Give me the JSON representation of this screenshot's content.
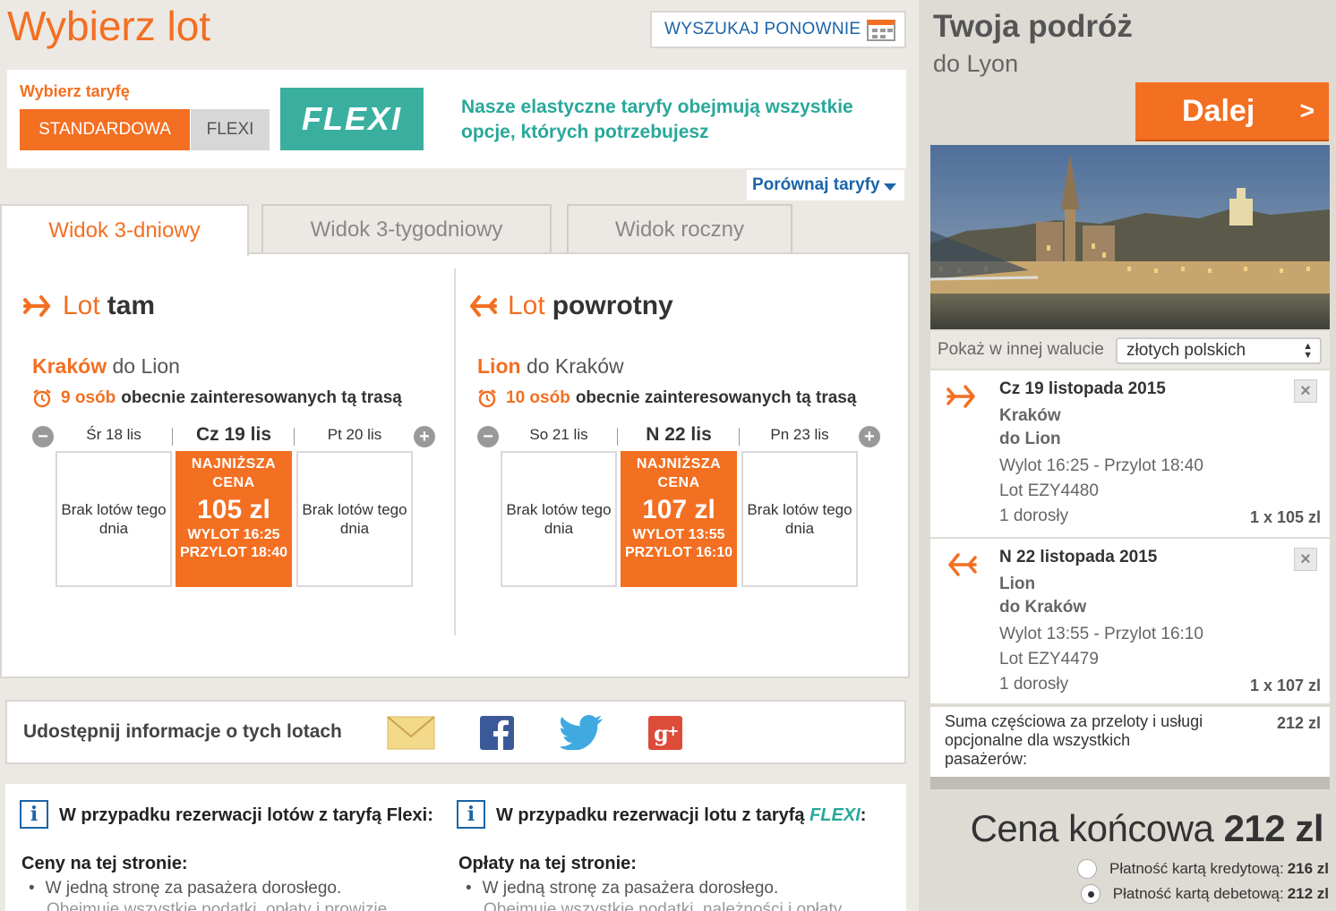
{
  "header": {
    "title": "Wybierz lot",
    "search_again": "WYSZUKAJ PONOWNIE"
  },
  "fare": {
    "label": "Wybierz taryfę",
    "standard": "STANDARDOWA",
    "flexi": "FLEXI",
    "logo": "FLEXI",
    "promo": "Nasze elastyczne taryfy obejmują wszystkie opcje, których potrzebujesz",
    "compare": "Porównaj taryfy"
  },
  "tabs": [
    "Widok 3-dniowy",
    "Widok 3-tygodniowy",
    "Widok roczny"
  ],
  "outbound": {
    "head1": "Lot",
    "head2": "tam",
    "from": "Kraków",
    "to": "do Lion",
    "interest_num": "9 osób",
    "interest_text": "obecnie zainteresowanych tą trasą",
    "days": [
      "Śr 18 lis",
      "Cz 19 lis",
      "Pt 20 lis"
    ],
    "no_flights": "Brak lotów tego dnia",
    "best_label": "NAJNIŻSZA CENA",
    "best_price": "105 zl",
    "best_dep": "WYLOT 16:25",
    "best_arr": "PRZYLOT 18:40"
  },
  "inbound": {
    "head1": "Lot",
    "head2": "powrotny",
    "from": "Lion",
    "to": "do Kraków",
    "interest_num": "10 osób",
    "interest_text": "obecnie zainteresowanych tą trasą",
    "days": [
      "So 21 lis",
      "N 22 lis",
      "Pn 23 lis"
    ],
    "no_flights": "Brak lotów tego dnia",
    "best_label": "NAJNIŻSZA CENA",
    "best_price": "107 zl",
    "best_dep": "WYLOT 13:55",
    "best_arr": "PRZYLOT 16:10"
  },
  "share": {
    "label": "Udostępnij informacje o tych lotach"
  },
  "info": {
    "c1_title": "W przypadku rezerwacji lotów z taryfą Flexi:",
    "c1_sub": "Ceny na tej stronie:",
    "c1_item": "W jedną stronę za pasażera dorosłego.",
    "c1_item2": "Obejmuje wszystkie podatki, opłaty i prowizje",
    "c2_title_pre": "W przypadku rezerwacji lotu z taryfą",
    "c2_title_flexi": "FLEXI",
    "c2_title_post": ":",
    "c2_sub": "Opłaty na tej stronie:",
    "c2_item": "W jedną stronę za pasażera dorosłego.",
    "c2_item2": "Obejmuje wszystkie podatki, należności i opłaty"
  },
  "sidebar": {
    "title": "Twoja podróż",
    "dest": "do Lyon",
    "next": "Dalej",
    "next_arrow": ">",
    "currency_label": "Pokaż w innej walucie",
    "currency_value": "złotych polskich",
    "legs": [
      {
        "date": "Cz 19 listopada 2015",
        "from": "Kraków",
        "to": "do Lion",
        "times": "Wylot 16:25 - Przylot 18:40",
        "flight": "Lot EZY4480",
        "pax": "1 dorosły",
        "price": "1 x 105 zl"
      },
      {
        "date": "N 22 listopada 2015",
        "from": "Lion",
        "to": "do Kraków",
        "times": "Wylot 13:55 - Przylot 16:10",
        "flight": "Lot EZY4479",
        "pax": "1 dorosły",
        "price": "1 x 107 zl"
      }
    ],
    "subtotal_label": "Suma częściowa za przeloty i usługi opcjonalne dla wszystkich pasażerów:",
    "subtotal_value": "212 zl",
    "final_label": "Cena końcowa",
    "final_value": "212 zl",
    "pay_credit_label": "Płatność kartą kredytową:",
    "pay_credit_value": "216 zl",
    "pay_debit_label": "Płatność kartą debetową:",
    "pay_debit_value": "212 zl"
  },
  "colors": {
    "accent": "#f36f21",
    "link": "#1b64a8",
    "flexi": "#28a89a"
  }
}
